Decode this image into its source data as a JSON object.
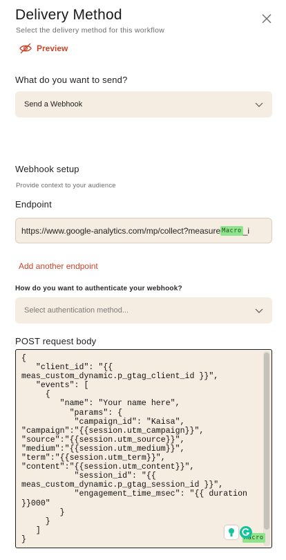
{
  "header": {
    "title": "Delivery Method",
    "subtitle": "Select the delivery method for this workflow",
    "preview_label": "Preview"
  },
  "send": {
    "question": "What do you want to send?",
    "selected": "Send a Webhook"
  },
  "webhook": {
    "section_title": "Webhook setup",
    "section_hint": "Provide context to your audience",
    "endpoint_label": "Endpoint",
    "endpoint_value": "https://www.google-analytics.com/mp/collect?measure",
    "endpoint_macro": "Macro",
    "endpoint_tail": "_i",
    "add_endpoint": "Add another endpoint"
  },
  "auth": {
    "question": "How do you want to authenticate your webhook?",
    "placeholder": "Select authentication method..."
  },
  "body": {
    "label": "POST request body",
    "code": "{\n   \"client_id\": \"{{\nmeas_custom_dynamic.p_gtag_client_id }}\",\n   \"events\": [\n     {\n        \"name\": \"Your name here\",\n          \"params\": {\n           \"campaign_id\": \"Kaisa\",\n\"campaign\":\"{{session.utm_campaign}}\",\n\"source\":\"{{session.utm_source}}\",\n\"medium\":\"{{session.utm_medium}}\",\n\"term\":\"{{session.utm_term}}\",\n\"content\":\"{{session.utm_content}}\",\n           \"session_id\": \"{{\nmeas_custom_dynamic.p_gtag_session_id }}\",\n           \"engagement_time_msec\": \"{{ duration\n}}000\"\n        }\n     }\n   ]\n}",
    "macro": "Macro"
  },
  "colors": {
    "accent": "#c9452b",
    "field_bg": "#f6ede2",
    "macro_bg": "#8fe38a",
    "grammarly": "#15c39a"
  }
}
